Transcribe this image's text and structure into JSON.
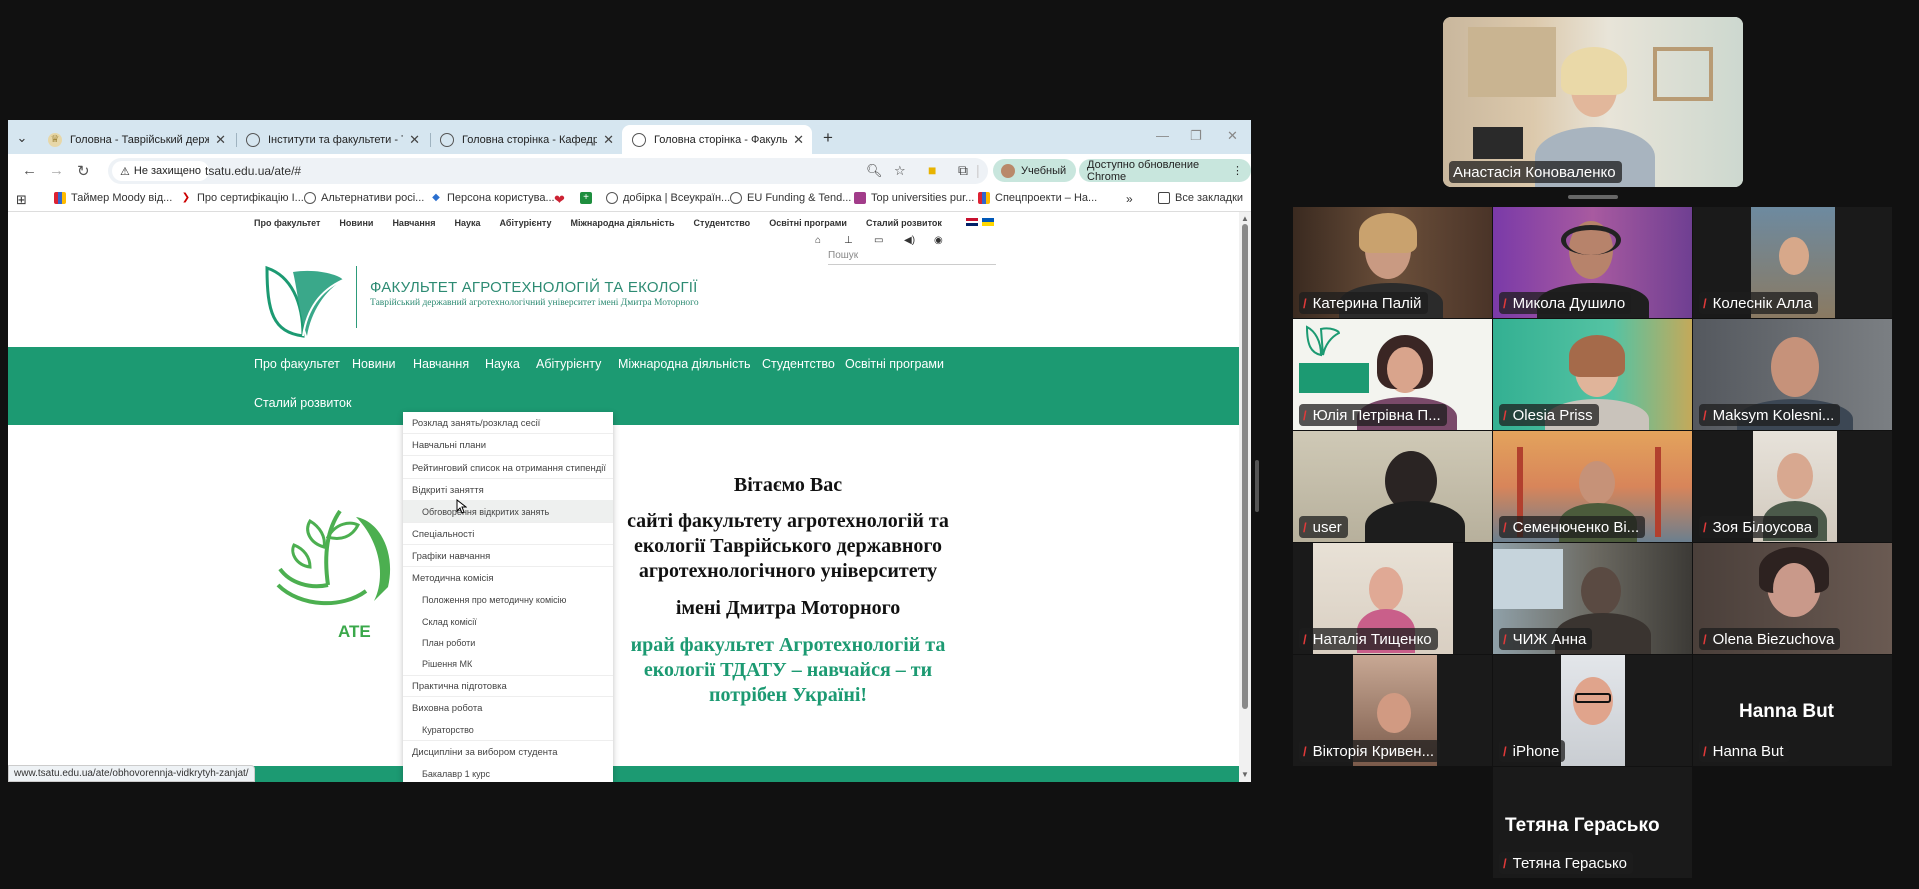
{
  "browser": {
    "tabs": [
      {
        "title": "Головна - Таврійський держа"
      },
      {
        "title": "Інститути та факультети - Тавр"
      },
      {
        "title": "Головна сторінка - Кафедра х"
      },
      {
        "title": "Головна сторінка - Факульте"
      }
    ],
    "security_label": "Не захищено",
    "url": "tsatu.edu.ua/ate/#",
    "profile_label": "Учебный",
    "update_label": "Доступно обновление Chrome",
    "bookmarks": [
      "Таймер Moody від...",
      "Про сертифікацію І...",
      "Альтернативи росі...",
      "Персона користува...",
      "добірка | Всеукраїн...",
      "EU Funding & Tend...",
      "Top universities pur...",
      "Спецпроекти – На..."
    ],
    "all_bookmarks_label": "Все закладки",
    "status_url": "www.tsatu.edu.ua/ate/obhovorennja-vidkrytyh-zanjat/"
  },
  "site": {
    "top_nav": [
      "Про факультет",
      "Новини",
      "Навчання",
      "Наука",
      "Абітурієнту",
      "Міжнародна діяльність",
      "Студентство",
      "Освітні програми",
      "Сталий розвиток"
    ],
    "search_placeholder": "Пошук",
    "faculty_title": "ФАКУЛЬТЕТ АГРОТЕХНОЛОГІЙ ТА ЕКОЛОГІЇ",
    "faculty_subtitle": "Таврійський державний агротехнологічний університет імені Дмитра Моторного",
    "main_nav": [
      "Про факультет",
      "Новини",
      "Навчання",
      "Наука",
      "Абітурієнту",
      "Міжнародна діяльність",
      "Студентство",
      "Освітні програми",
      "Сталий розвиток"
    ],
    "dropdown": [
      {
        "label": "Розклад занять/розклад сесії",
        "sub": false
      },
      {
        "label": "Навчальні плани",
        "sub": false
      },
      {
        "label": "Рейтинговий список на отримання стипендії",
        "sub": false
      },
      {
        "label": "Відкриті заняття",
        "sub": false
      },
      {
        "label": "Обговорення відкритих занять",
        "sub": true
      },
      {
        "label": "Спеціальності",
        "sub": false
      },
      {
        "label": "Графіки навчання",
        "sub": false
      },
      {
        "label": "Методична комісія",
        "sub": false
      },
      {
        "label": "Положення про методичну комісію",
        "sub": true
      },
      {
        "label": "Склад комісії",
        "sub": true
      },
      {
        "label": "План роботи",
        "sub": true
      },
      {
        "label": "Рішення МК",
        "sub": true
      },
      {
        "label": "Практична підготовка",
        "sub": false
      },
      {
        "label": "Виховна робота",
        "sub": false
      },
      {
        "label": "Кураторство",
        "sub": true
      },
      {
        "label": "Дисципліни за вибором студента",
        "sub": false
      },
      {
        "label": "Бакалавр 1 курс",
        "sub": true
      }
    ],
    "welcome_heading": "Вітаємо Вас",
    "welcome_lines": [
      "сайті  факультету агротехнологій та",
      "екології Таврійського державного",
      "агротехнологічного університету",
      "імені Дмитра Моторного"
    ],
    "slogan_lines": [
      "ирай факультет Агротехнологій та",
      "екології ТДАТУ – навчайся – ти",
      "потрібен Україні!"
    ],
    "ate_label": "ATE"
  },
  "meeting": {
    "speaker": "Анастасія Коноваленко",
    "participants": [
      {
        "name": "Катерина Палій"
      },
      {
        "name": "Микола Душило"
      },
      {
        "name": "Колеснік Алла"
      },
      {
        "name": "Юлія Петрівна П..."
      },
      {
        "name": "Olesia Priss"
      },
      {
        "name": "Maksym Kolesni..."
      },
      {
        "name": "user"
      },
      {
        "name": "Семенюченко Ві..."
      },
      {
        "name": "Зоя Білоусова"
      },
      {
        "name": "Наталія Тищенко"
      },
      {
        "name": "ЧИЖ Анна"
      },
      {
        "name": "Olena Biezuchova"
      },
      {
        "name": "Вікторія Кривен..."
      },
      {
        "name": "iPhone"
      },
      {
        "name": "Hanna But"
      }
    ],
    "hanna_big": "Hanna But",
    "tetiana_big": "Тетяна Гераськo",
    "tetiana_label": "Тетяна Гераськo"
  }
}
